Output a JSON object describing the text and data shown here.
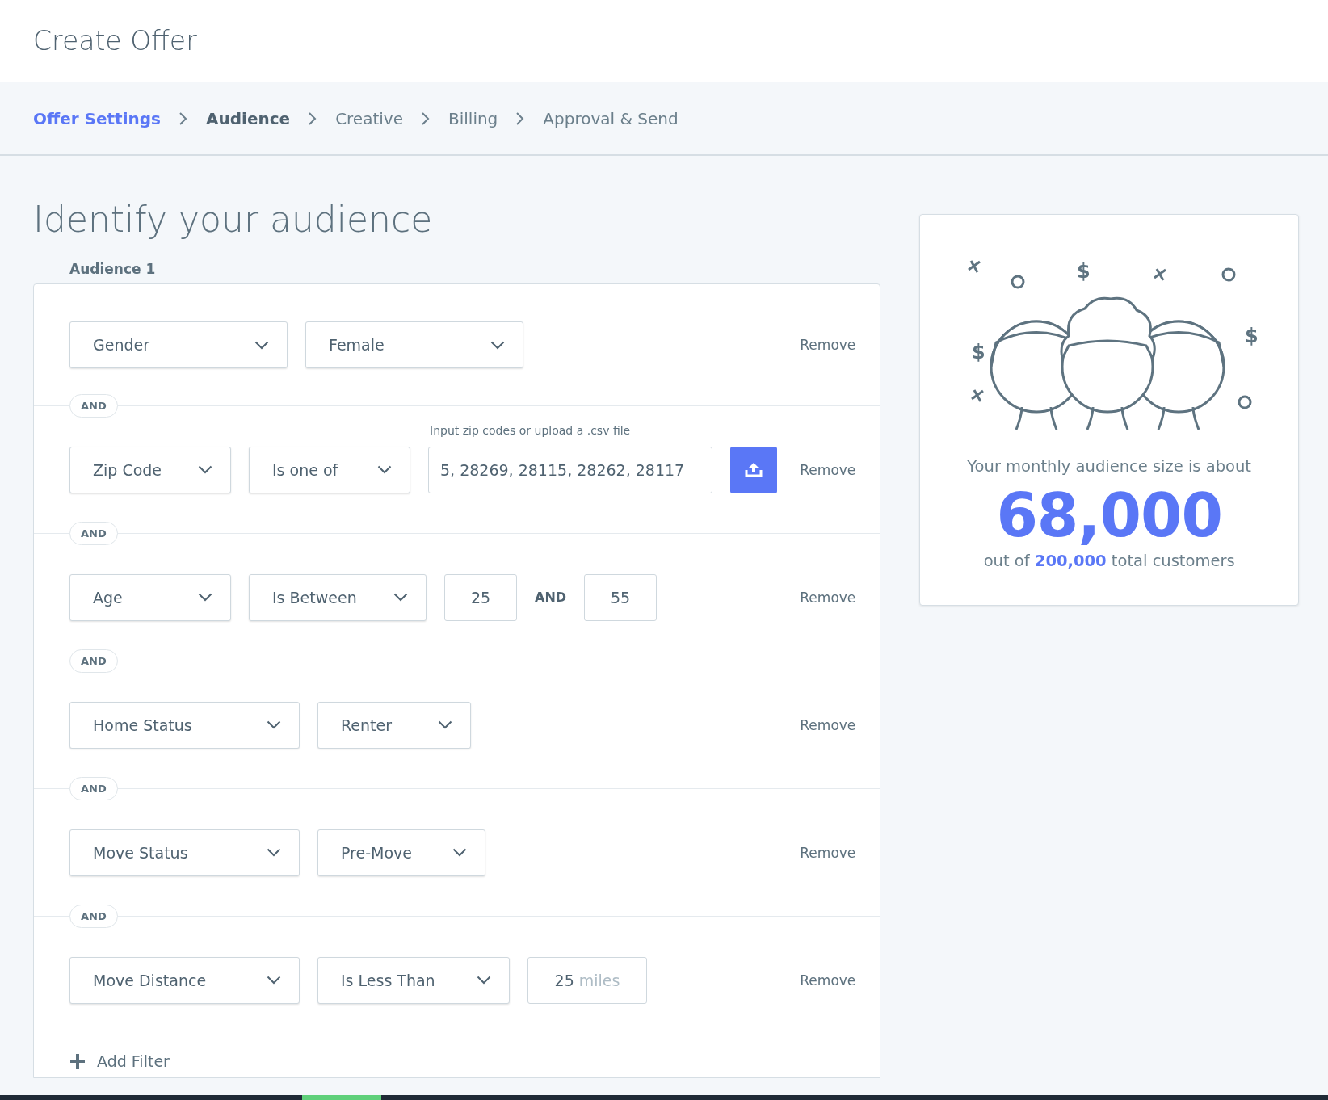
{
  "page_title": "Create Offer",
  "steps": [
    {
      "label": "Offer Settings",
      "completed": true,
      "selected": false
    },
    {
      "label": "Audience",
      "completed": false,
      "selected": true
    },
    {
      "label": "Creative",
      "completed": false,
      "selected": false
    },
    {
      "label": "Billing",
      "completed": false,
      "selected": false
    },
    {
      "label": "Approval & Send",
      "completed": false,
      "selected": false
    }
  ],
  "heading": "Identify your audience",
  "audience_label": "Audience 1",
  "filters": [
    {
      "fields": [
        {
          "kind": "dropdown",
          "value": "Gender"
        },
        {
          "kind": "dropdown",
          "value": "Female"
        }
      ],
      "remove": "Remove"
    },
    {
      "joiner": "AND",
      "fields": [
        {
          "kind": "dropdown",
          "value": "Zip Code"
        },
        {
          "kind": "dropdown",
          "value": "Is one of"
        },
        {
          "kind": "text",
          "label": "Input zip codes or upload a .csv file",
          "value": "5, 28269, 28115, 28262, 28117"
        },
        {
          "kind": "upload"
        }
      ],
      "remove": "Remove"
    },
    {
      "joiner": "AND",
      "fields": [
        {
          "kind": "dropdown",
          "value": "Age"
        },
        {
          "kind": "dropdown",
          "value": "Is Between"
        },
        {
          "kind": "number",
          "value": "25"
        },
        {
          "kind": "connector",
          "text": "AND"
        },
        {
          "kind": "number",
          "value": "55"
        }
      ],
      "remove": "Remove"
    },
    {
      "joiner": "AND",
      "fields": [
        {
          "kind": "dropdown",
          "value": "Home Status"
        },
        {
          "kind": "dropdown",
          "value": "Renter"
        }
      ],
      "remove": "Remove"
    },
    {
      "joiner": "AND",
      "fields": [
        {
          "kind": "dropdown",
          "value": "Move Status"
        },
        {
          "kind": "dropdown",
          "value": "Pre-Move"
        }
      ],
      "remove": "Remove"
    },
    {
      "joiner": "AND",
      "fields": [
        {
          "kind": "dropdown",
          "value": "Move Distance"
        },
        {
          "kind": "dropdown",
          "value": "Is Less Than"
        },
        {
          "kind": "unit",
          "value": "25",
          "unit": "miles"
        }
      ],
      "remove": "Remove"
    }
  ],
  "add_filter": "Add Filter",
  "summary": {
    "illustration_marks": [
      "$",
      "$",
      "$"
    ],
    "caption": "Your monthly audience size is about",
    "size": "68,000",
    "total": "out of **200,000** total customers"
  }
}
